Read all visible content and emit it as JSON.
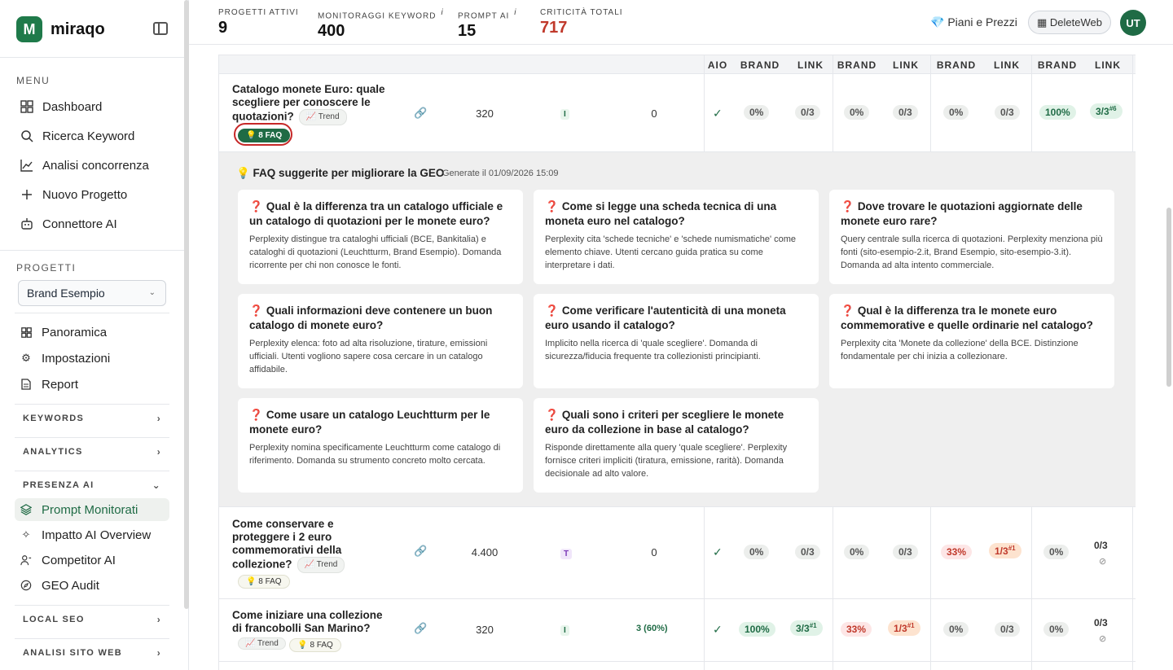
{
  "brand": {
    "name": "miraqo",
    "logo_letter": "M"
  },
  "sidebar": {
    "menu_label": "MENU",
    "menu": [
      {
        "label": "Dashboard",
        "icon": "grid-icon"
      },
      {
        "label": "Ricerca Keyword",
        "icon": "search-icon"
      },
      {
        "label": "Analisi concorrenza",
        "icon": "chart-line-icon"
      },
      {
        "label": "Nuovo Progetto",
        "icon": "plus-icon"
      },
      {
        "label": "Connettore AI",
        "icon": "robot-icon"
      }
    ],
    "projects_label": "PROGETTI",
    "project_select": "Brand Esempio",
    "project_items": [
      {
        "label": "Panoramica",
        "icon": "grid-icon"
      },
      {
        "label": "Impostazioni",
        "icon": "gear-icon"
      },
      {
        "label": "Report",
        "icon": "document-icon"
      }
    ],
    "groups": {
      "keywords": "KEYWORDS",
      "analytics": "ANALYTICS",
      "presenza_ai": "PRESENZA AI",
      "local_seo": "LOCAL SEO",
      "analisi_sito": "ANALISI SITO WEB"
    },
    "ai_items": [
      {
        "label": "Prompt Monitorati",
        "icon": "layers-icon"
      },
      {
        "label": "Impatto AI Overview",
        "icon": "sparkle-icon"
      },
      {
        "label": "Competitor AI",
        "icon": "users-icon"
      },
      {
        "label": "GEO Audit",
        "icon": "compass-icon"
      }
    ]
  },
  "topbar": {
    "stats": [
      {
        "label": "PROGETTI ATTIVI",
        "value": "9"
      },
      {
        "label": "MONITORAGGI KEYWORD",
        "value": "400",
        "info": "i"
      },
      {
        "label": "PROMPT AI",
        "value": "15",
        "info": "i"
      },
      {
        "label": "CRITICITÀ TOTALI",
        "value": "717"
      }
    ],
    "plans": "Piani e Prezzi",
    "workspace": "DeleteWeb",
    "avatar": "UT"
  },
  "table": {
    "headers": [
      "AIO",
      "BRAND",
      "LINK",
      "BRAND",
      "LINK",
      "BRAND",
      "LINK",
      "BRAND",
      "LINK"
    ],
    "rows": [
      {
        "keyword": "Catalogo monete Euro: quale scegliere per conoscere le quotazioni?",
        "trend": "📈 Trend",
        "faq": "💡 8 FAQ",
        "volume": "320",
        "intent": "I",
        "traffic": "0",
        "cells": [
          "0%",
          "0/3",
          "0%",
          "0/3",
          "0%",
          "0/3",
          "100%",
          "3/3"
        ],
        "sup": {
          "7": "#6"
        }
      },
      {
        "keyword": "Come conservare e proteggere i 2 euro commemorativi della collezione?",
        "trend": "📈 Trend",
        "faq": "💡 8 FAQ",
        "volume": "4.400",
        "intent": "T",
        "traffic": "0",
        "cells": [
          "0%",
          "0/3",
          "0%",
          "0/3",
          "33%",
          "1/3",
          "0%",
          "0/3"
        ],
        "sup": {
          "5": "#1"
        },
        "no_symbol": "⊘"
      },
      {
        "keyword": "Come iniziare una collezione di francobolli San Marino?",
        "trend": "📈 Trend",
        "faq": "💡 8 FAQ",
        "volume": "320",
        "intent": "I",
        "traffic": "3 (60%)",
        "cells": [
          "100%",
          "3/3",
          "33%",
          "1/3",
          "0%",
          "0/3",
          "0%",
          "0/3"
        ],
        "sup": {
          "1": "#1",
          "3": "#1"
        },
        "no_symbol": "⊘"
      }
    ]
  },
  "faq": {
    "title": "💡 FAQ suggerite per migliorare la GEO",
    "generated": "Generate il 01/09/2026 15:09",
    "qmark": "❓",
    "items": [
      {
        "q": "Qual è la differenza tra un catalogo ufficiale e un catalogo di quotazioni per le monete euro?",
        "d": "Perplexity distingue tra cataloghi ufficiali (BCE, Bankitalia) e cataloghi di quotazioni (Leuchtturm, Brand Esempio). Domanda ricorrente per chi non conosce le fonti."
      },
      {
        "q": "Come si legge una scheda tecnica di una moneta euro nel catalogo?",
        "d": "Perplexity cita 'schede tecniche' e 'schede numismatiche' come elemento chiave. Utenti cercano guida pratica su come interpretare i dati."
      },
      {
        "q": "Dove trovare le quotazioni aggiornate delle monete euro rare?",
        "d": "Query centrale sulla ricerca di quotazioni. Perplexity menziona più fonti (sito-esempio-2.it, Brand Esempio, sito-esempio-3.it). Domanda ad alta intento commerciale."
      },
      {
        "q": "Quali informazioni deve contenere un buon catalogo di monete euro?",
        "d": "Perplexity elenca: foto ad alta risoluzione, tirature, emissioni ufficiali. Utenti vogliono sapere cosa cercare in un catalogo affidabile."
      },
      {
        "q": "Come verificare l'autenticità di una moneta euro usando il catalogo?",
        "d": "Implicito nella ricerca di 'quale scegliere'. Domanda di sicurezza/fiducia frequente tra collezionisti principianti."
      },
      {
        "q": "Qual è la differenza tra le monete euro commemorative e quelle ordinarie nel catalogo?",
        "d": "Perplexity cita 'Monete da collezione' della BCE. Distinzione fondamentale per chi inizia a collezionare."
      },
      {
        "q": "Come usare un catalogo Leuchtturm per le monete euro?",
        "d": "Perplexity nomina specificamente Leuchtturm come catalogo di riferimento. Domanda su strumento concreto molto cercata."
      },
      {
        "q": "Quali sono i criteri per scegliere le monete euro da collezione in base al catalogo?",
        "d": "Risponde direttamente alla query 'quale scegliere'. Perplexity fornisce criteri impliciti (tiratura, emissione, rarità). Domanda decisionale ad alto valore."
      }
    ]
  },
  "colors": {
    "brand": "#1f6b45",
    "critical": "#c0392b"
  }
}
